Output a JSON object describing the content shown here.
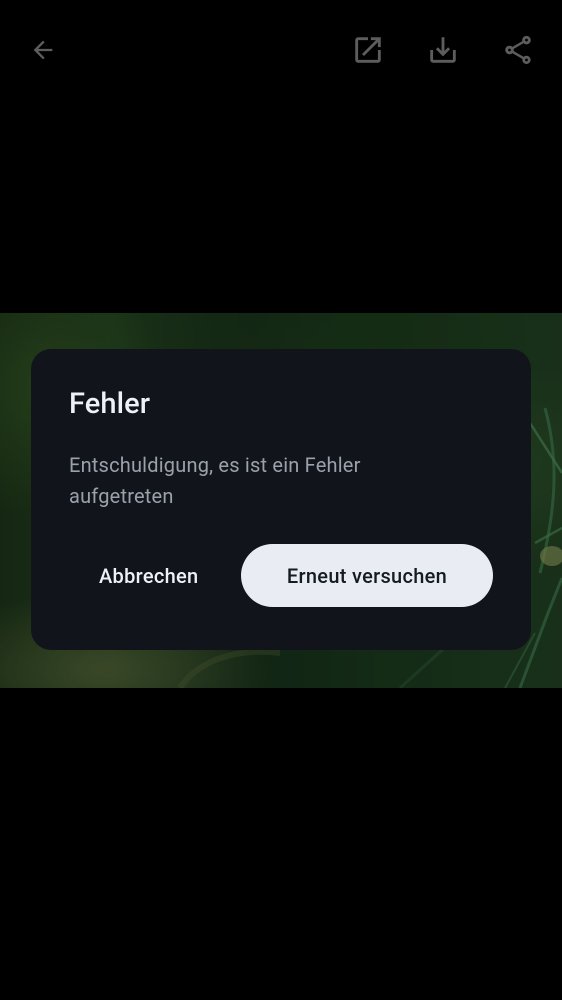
{
  "app_bar": {
    "back_icon": "arrow-left-icon",
    "actions": [
      {
        "icon": "open-in-new-icon"
      },
      {
        "icon": "download-icon"
      },
      {
        "icon": "share-icon"
      }
    ],
    "icon_color": "#5d5d5d"
  },
  "photo": {
    "subject": "green plant stems, blurred background",
    "dim": true
  },
  "dialog": {
    "title": "Fehler",
    "message": "Entschuldigung, es ist ein Fehler aufgetreten",
    "cancel_label": "Abbrechen",
    "retry_label": "Erneut versuchen",
    "background_color": "#11151b",
    "primary_button_color": "#e9edf3"
  },
  "colors": {
    "screen_background": "#000000",
    "text_primary": "#eef1f6",
    "text_secondary": "#9aa1ab"
  }
}
